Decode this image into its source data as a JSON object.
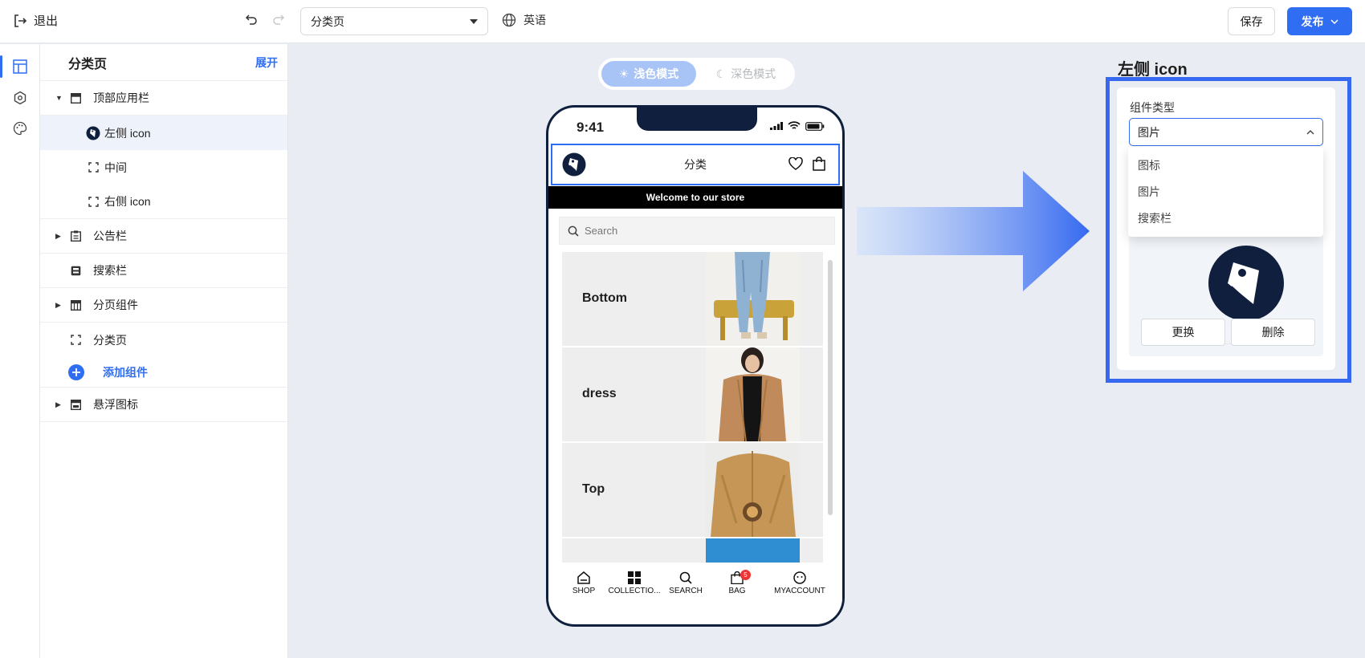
{
  "topbar": {
    "exit_label": "退出",
    "page_select_value": "分类页",
    "language_label": "英语",
    "save_label": "保存",
    "publish_label": "发布"
  },
  "tree": {
    "title": "分类页",
    "expand_label": "展开",
    "items": [
      {
        "label": "顶部应用栏"
      },
      {
        "label": "左侧 icon"
      },
      {
        "label": "中间"
      },
      {
        "label": "右侧 icon"
      },
      {
        "label": "公告栏"
      },
      {
        "label": "搜索栏"
      },
      {
        "label": "分页组件"
      },
      {
        "label": "分类页"
      },
      {
        "label": "添加组件"
      },
      {
        "label": "悬浮图标"
      }
    ]
  },
  "mode_toggle": {
    "light_label": "浅色模式",
    "dark_label": "深色模式",
    "selected": "light"
  },
  "phone": {
    "time": "9:41",
    "appbar_title": "分类",
    "announcement": "Welcome to our store",
    "search_placeholder": "Search",
    "categories": [
      {
        "name": "Bottom"
      },
      {
        "name": "dress"
      },
      {
        "name": "Top"
      }
    ],
    "tabs": [
      {
        "label": "SHOP"
      },
      {
        "label": "COLLECTIO..."
      },
      {
        "label": "SEARCH"
      },
      {
        "label": "BAG",
        "badge": "5"
      },
      {
        "label": "MYACCOUNT"
      }
    ]
  },
  "right_panel": {
    "title": "左侧 icon",
    "field_label": "组件类型",
    "select_value": "图片",
    "options": [
      "图标",
      "图片",
      "搜索栏"
    ],
    "replace_label": "更换",
    "delete_label": "删除"
  },
  "colors": {
    "accent": "#2f6ef3",
    "highlight_frame": "#3669f0",
    "phone_frame": "#0f1f3d"
  }
}
